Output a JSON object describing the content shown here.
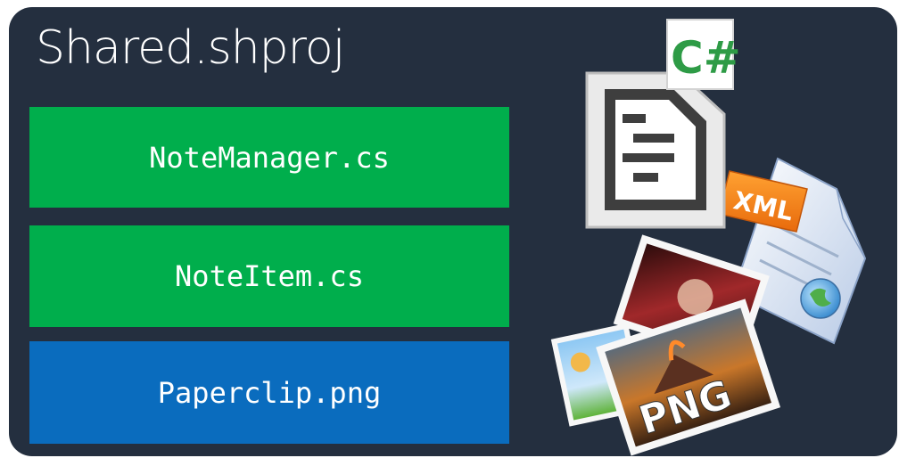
{
  "project": {
    "title": "Shared.shproj"
  },
  "files": [
    {
      "name": "NoteManager.cs",
      "color": "#00ae4c"
    },
    {
      "name": "NoteItem.cs",
      "color": "#00ae4c"
    },
    {
      "name": "Paperclip.png",
      "color": "#0a6cbe"
    }
  ],
  "icons": {
    "csharp": {
      "name": "csharp-file-icon",
      "label": "C#"
    },
    "xml": {
      "name": "xml-file-icon",
      "label": "XML"
    },
    "png": {
      "name": "png-images-icon",
      "label": "PNG"
    }
  },
  "colors": {
    "background": "#242f3f",
    "code_file": "#00ae4c",
    "asset_file": "#0a6cbe"
  }
}
